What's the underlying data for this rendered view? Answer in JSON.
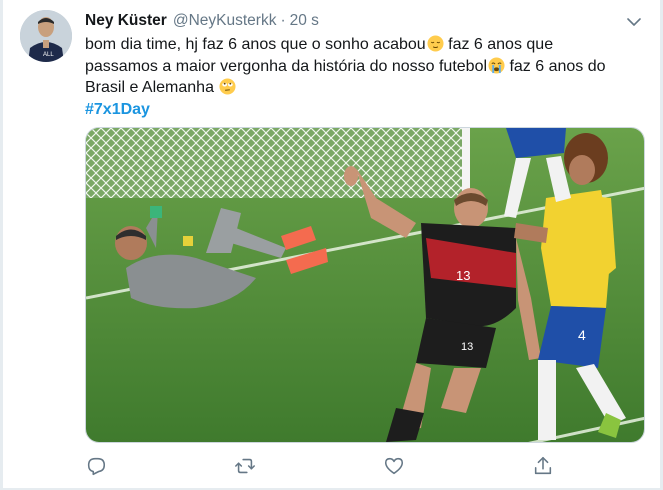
{
  "tweet": {
    "author_name": "Ney Küster",
    "author_handle": "@NeyKusterkk",
    "separator": "·",
    "timestamp": "20 s",
    "text_lines": [
      {
        "text": "bom dia time, hj faz 6 anos que o sonho acabou",
        "emoji": "relieved-face",
        "after": " faz 6 anos que"
      },
      {
        "text": "passamos a maior vergonha da história do nosso futebol",
        "emoji": "crying-face",
        "after": " faz 6 anos do"
      },
      {
        "text": "Brasil e Alemanha",
        "emoji": "rolling-eyes-face",
        "after": ""
      }
    ],
    "hashtag": "#7x1Day",
    "media": {
      "left_player_number": "13",
      "shorts_number": "13",
      "right_player_number": "4"
    }
  },
  "icons": {
    "caret": "chevron-down-icon",
    "actions": [
      "reply-icon",
      "retweet-icon",
      "like-icon",
      "share-icon"
    ]
  },
  "colors": {
    "text": "#14171a",
    "secondary": "#657786",
    "link": "#1b95e0",
    "pitch": "#4f8f3a",
    "germany_red": "#b3222a",
    "brazil_yellow": "#f2d230",
    "brazil_blue": "#1f4fa8"
  }
}
